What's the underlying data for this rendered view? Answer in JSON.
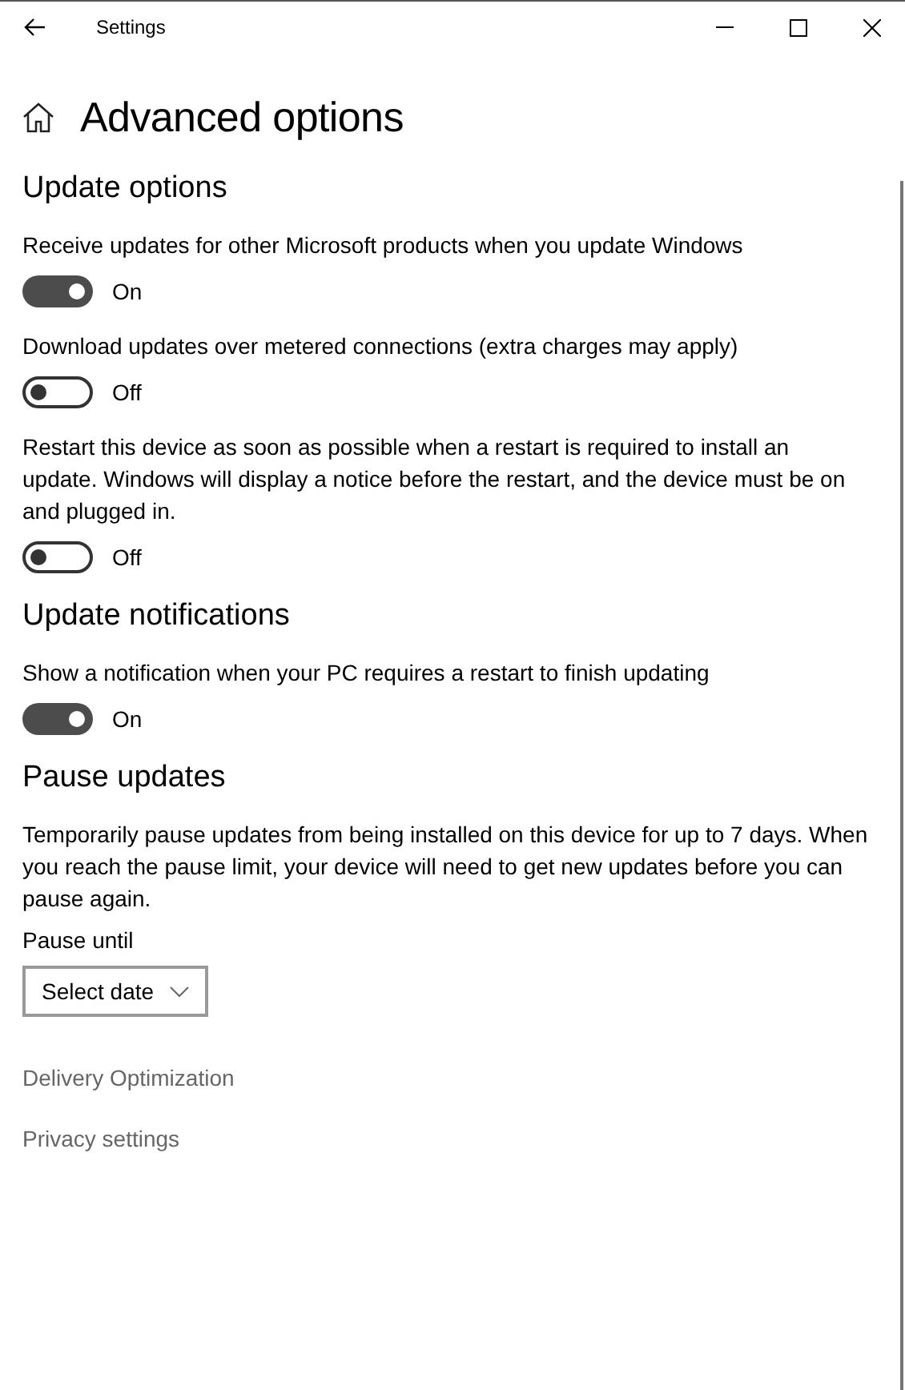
{
  "window": {
    "title": "Settings"
  },
  "page_title": "Advanced options",
  "sections": [
    {
      "title": "Update options",
      "items": [
        {
          "kind": "toggle",
          "label": "Receive updates for other Microsoft products when you update Windows",
          "on": true,
          "state_text": "On"
        },
        {
          "kind": "toggle",
          "label": "Download updates over metered connections (extra charges may apply)",
          "on": false,
          "state_text": "Off"
        },
        {
          "kind": "toggle",
          "label": "Restart this device as soon as possible when a restart is required to install an update. Windows will display a notice before the restart, and the device must be on and plugged in.",
          "on": false,
          "state_text": "Off"
        }
      ]
    },
    {
      "title": "Update notifications",
      "items": [
        {
          "kind": "toggle",
          "label": "Show a notification when your PC requires a restart to finish updating",
          "on": true,
          "state_text": "On"
        }
      ]
    },
    {
      "title": "Pause updates",
      "items": [
        {
          "kind": "text",
          "text": "Temporarily pause updates from being installed on this device for up to 7 days. When you reach the pause limit, your device will need to get new updates before you can pause again."
        },
        {
          "kind": "dropdown",
          "label": "Pause until",
          "value": "Select date"
        }
      ]
    }
  ],
  "links": [
    "Delivery Optimization",
    "Privacy settings"
  ]
}
